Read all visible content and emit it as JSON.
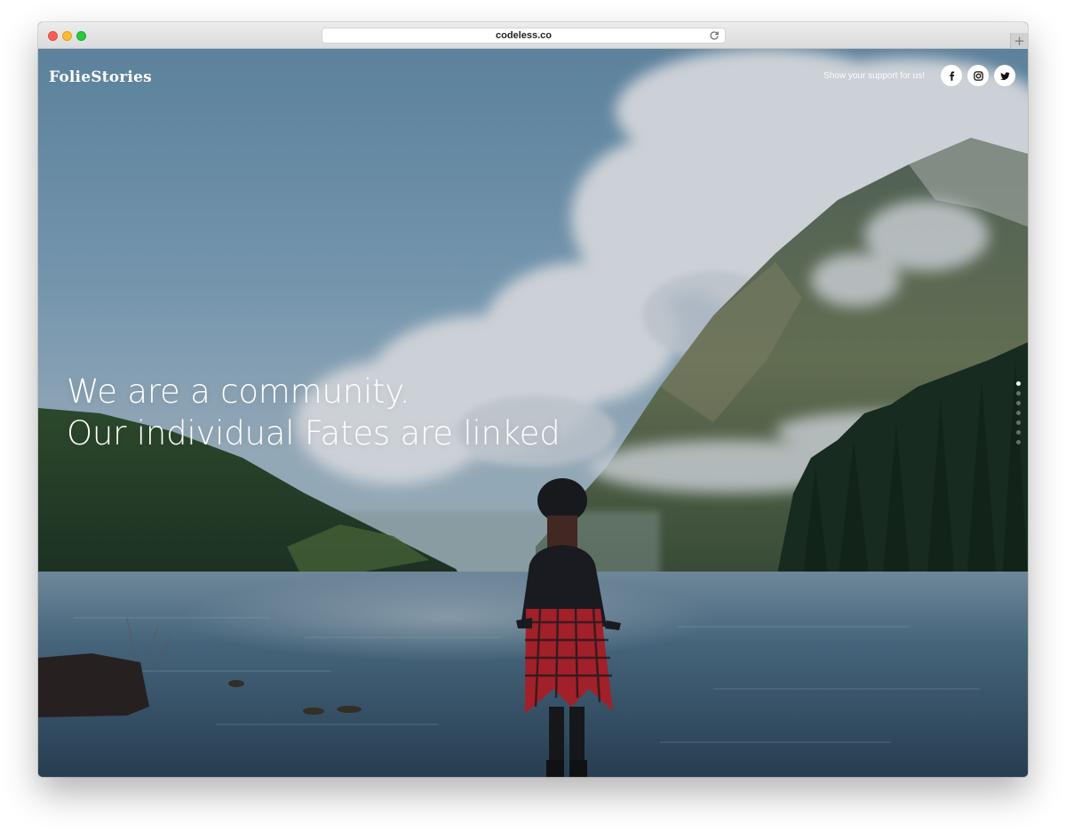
{
  "browser": {
    "url": "codeless.co",
    "new_tab_label": "+"
  },
  "site": {
    "logo": "FolieStories",
    "support_text": "Show your support for us!",
    "social": [
      {
        "name": "facebook-icon"
      },
      {
        "name": "instagram-icon"
      },
      {
        "name": "twitter-icon"
      }
    ]
  },
  "hero": {
    "line1": "We are a community.",
    "line2": "Our individual Fates are linked",
    "slides": 7,
    "active_slide": 1
  },
  "colors": {
    "sky": "#6f96b3",
    "cloud": "#e9ebee",
    "forest": "#1e3523",
    "lake": "#3c5c74",
    "plaid": "#c2242b"
  }
}
